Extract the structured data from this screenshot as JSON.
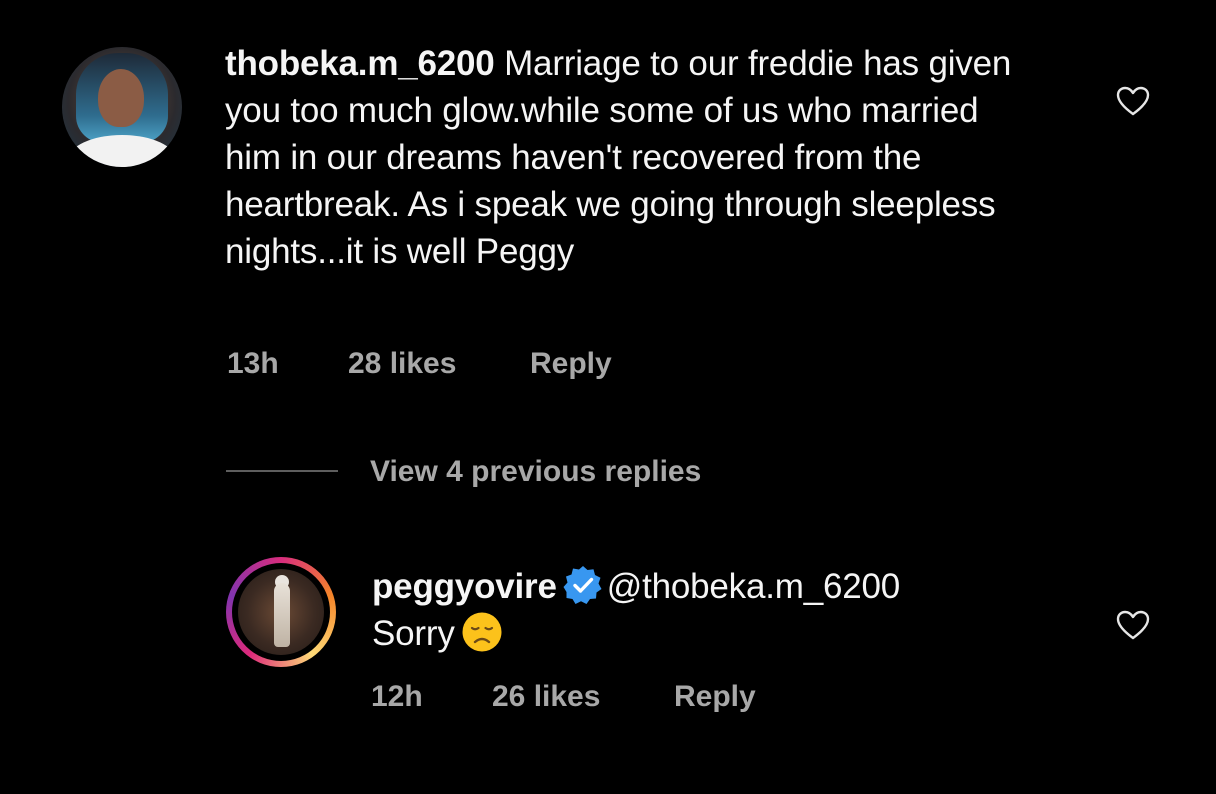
{
  "comments": [
    {
      "username": "thobeka.m_6200",
      "text": "Marriage to our freddie has given you too much glow.while some of us who married him in our dreams haven't recovered from the heartbreak. As i speak we going through sleepless nights...it is well Peggy",
      "time": "13h",
      "likes": "28 likes",
      "reply_label": "Reply"
    }
  ],
  "view_replies": "View 4 previous replies",
  "reply": {
    "username": "peggyovire",
    "mention": "@thobeka.m_6200",
    "text": "Sorry",
    "time": "12h",
    "likes": "26 likes",
    "reply_label": "Reply"
  },
  "icons": {
    "like": "heart-outline-icon",
    "verified": "verified-badge-icon",
    "emoji": "disappointed-face-emoji"
  },
  "colors": {
    "background": "#000000",
    "text": "#f5f5f5",
    "muted": "#a8a8a8",
    "verified": "#3897f0"
  }
}
